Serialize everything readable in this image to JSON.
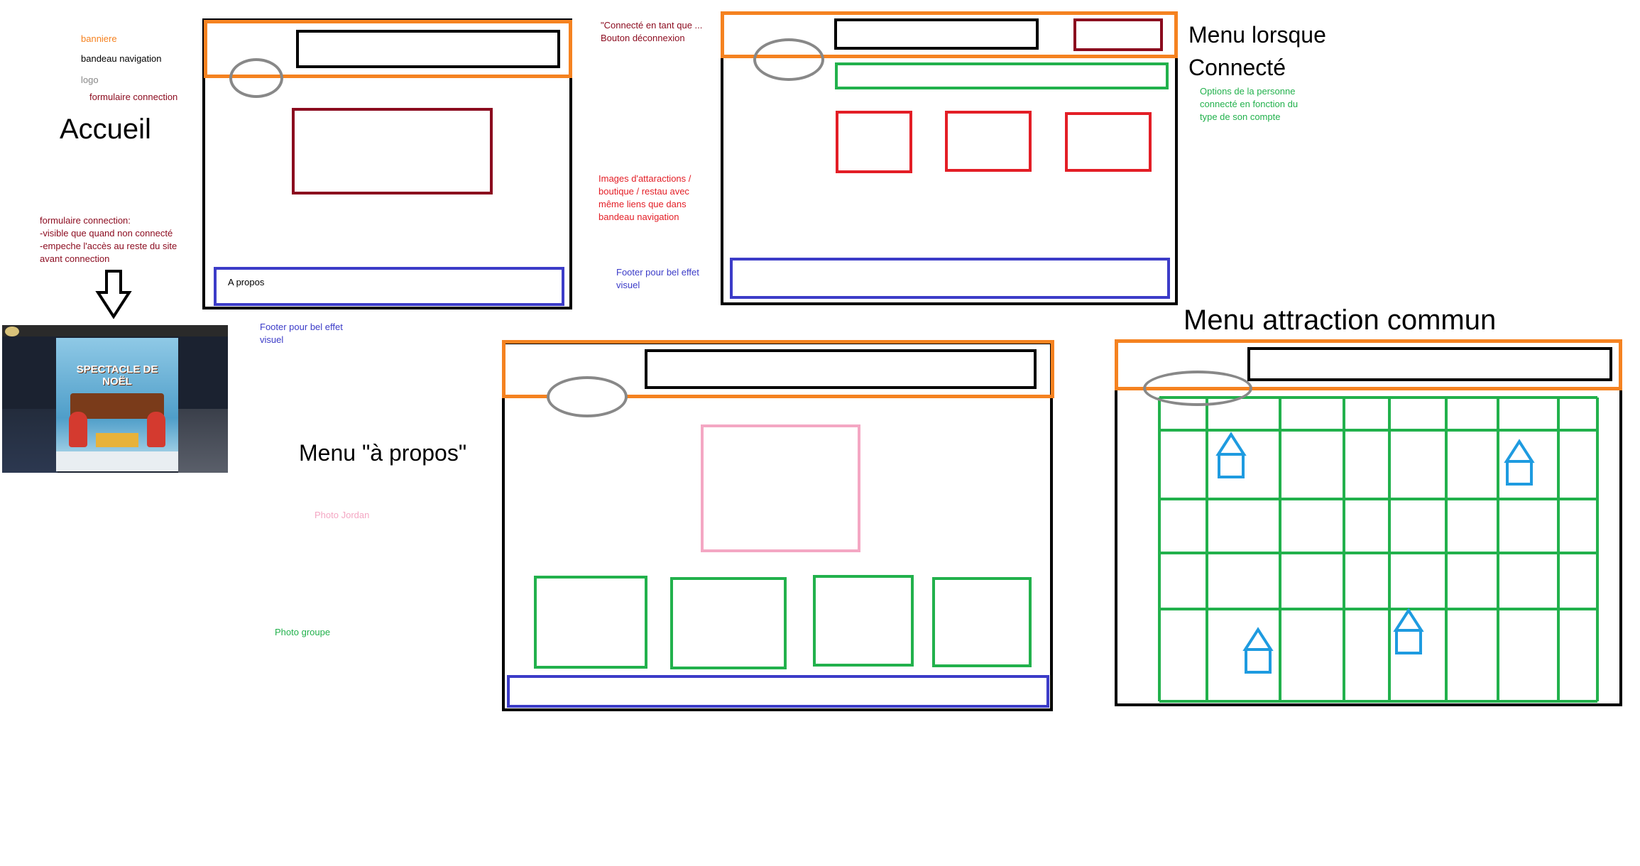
{
  "colors": {
    "banner": "#f58220",
    "nav": "#000000",
    "logo": "#888888",
    "login_form": "#8b0a1e",
    "footer": "#3c3cc8",
    "options": "#22b14c",
    "images": "#e31e26",
    "photo_jordan": "#f4a7c3",
    "attraction_icon": "#1e9be0"
  },
  "legend": {
    "banner": "banniere",
    "nav": "bandeau navigation",
    "logo": "logo",
    "login_form": "formulaire connection"
  },
  "accueil": {
    "title": "Accueil",
    "login_note": [
      "formulaire connection:",
      " -visible que quand non connecté",
      "-empeche l'accès au reste du site",
      "avant connection"
    ],
    "footer_label": "A propos",
    "footer_note": [
      "Footer pour bel effet",
      "visuel"
    ],
    "screenshot_logo": "SPECTACLE DE NOËL"
  },
  "connected": {
    "title": [
      "Menu lorsque",
      "Connecté"
    ],
    "logout_note": [
      "\"Connecté en tant que ...",
      "Bouton déconnexion"
    ],
    "options_note": [
      "Options de la personne",
      "connecté en fonction du",
      "type de son compte"
    ],
    "images_note": [
      "Images d'attaractions /",
      "boutique / restau avec",
      "même liens que dans",
      "bandeau navigation"
    ],
    "footer_note": [
      "Footer pour bel effet",
      "visuel"
    ]
  },
  "apropos": {
    "title": "Menu \"à propos\"",
    "photo_jordan": "Photo Jordan",
    "photo_groupe": "Photo groupe"
  },
  "attraction": {
    "title": "Menu attraction commun"
  }
}
